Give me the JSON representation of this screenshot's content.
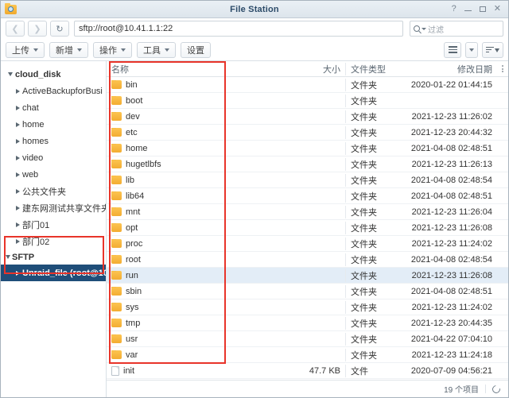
{
  "window": {
    "title": "File Station",
    "icon": "folder-search-icon",
    "controls": [
      {
        "name": "help-button",
        "glyph": "?"
      },
      {
        "name": "minimize-button",
        "glyph": "—"
      },
      {
        "name": "maximize-button",
        "glyph": "□"
      },
      {
        "name": "close-button",
        "glyph": "✕"
      }
    ]
  },
  "nav": {
    "back_icon": "chevron-left-icon",
    "forward_icon": "chevron-right-icon",
    "refresh_icon": "refresh-icon",
    "address_value": "sftp://root@10.41.1.1:22",
    "filter_placeholder": "过滤",
    "filter_icon": "search-icon"
  },
  "toolbar": {
    "buttons": [
      {
        "label": "上传",
        "name": "upload-button",
        "has_caret": true
      },
      {
        "label": "新增",
        "name": "create-button",
        "has_caret": true
      },
      {
        "label": "操作",
        "name": "action-button",
        "has_caret": true
      },
      {
        "label": "工具",
        "name": "tools-button",
        "has_caret": true
      },
      {
        "label": "设置",
        "name": "settings-button",
        "has_caret": false
      }
    ],
    "view_button": "list-view-icon",
    "view_caret": "chevron-down-icon",
    "sort_button": "sort-descending-icon"
  },
  "sidebar": {
    "root": {
      "label": "cloud_disk",
      "expanded": true
    },
    "items": [
      {
        "label": "ActiveBackupforBusi",
        "name": "sidebar-item-activebackupforbusi"
      },
      {
        "label": "chat",
        "name": "sidebar-item-chat"
      },
      {
        "label": "home",
        "name": "sidebar-item-home"
      },
      {
        "label": "homes",
        "name": "sidebar-item-homes"
      },
      {
        "label": "video",
        "name": "sidebar-item-video"
      },
      {
        "label": "web",
        "name": "sidebar-item-web"
      },
      {
        "label": "公共文件夹",
        "name": "sidebar-item-public-folder"
      },
      {
        "label": "建东网测试共享文件夹",
        "name": "sidebar-item-shared-test-folder"
      },
      {
        "label": "部门01",
        "name": "sidebar-item-dept01"
      },
      {
        "label": "部门02",
        "name": "sidebar-item-dept02"
      }
    ],
    "section": {
      "label": "SFTP",
      "expanded": true
    },
    "sftp_items": [
      {
        "label": "Unraid_file (root@10",
        "name": "sidebar-item-unraid-file",
        "selected": true
      }
    ]
  },
  "filelist": {
    "columns": {
      "name": "名称",
      "size": "大小",
      "type": "文件类型",
      "date": "修改日期",
      "menu_icon": "column-options-icon"
    },
    "rows": [
      {
        "name": "bin",
        "icon": "folder-icon",
        "size": "",
        "type": "文件夹",
        "date": "2020-01-22 01:44:15",
        "highlighted": false
      },
      {
        "name": "boot",
        "icon": "folder-icon",
        "size": "",
        "type": "文件夹",
        "date": "",
        "highlighted": false
      },
      {
        "name": "dev",
        "icon": "folder-icon",
        "size": "",
        "type": "文件夹",
        "date": "2021-12-23 11:26:02",
        "highlighted": false
      },
      {
        "name": "etc",
        "icon": "folder-icon",
        "size": "",
        "type": "文件夹",
        "date": "2021-12-23 20:44:32",
        "highlighted": false
      },
      {
        "name": "home",
        "icon": "folder-icon",
        "size": "",
        "type": "文件夹",
        "date": "2021-04-08 02:48:51",
        "highlighted": false
      },
      {
        "name": "hugetlbfs",
        "icon": "folder-icon",
        "size": "",
        "type": "文件夹",
        "date": "2021-12-23 11:26:13",
        "highlighted": false
      },
      {
        "name": "lib",
        "icon": "folder-icon",
        "size": "",
        "type": "文件夹",
        "date": "2021-04-08 02:48:54",
        "highlighted": false
      },
      {
        "name": "lib64",
        "icon": "folder-icon",
        "size": "",
        "type": "文件夹",
        "date": "2021-04-08 02:48:51",
        "highlighted": false
      },
      {
        "name": "mnt",
        "icon": "folder-icon",
        "size": "",
        "type": "文件夹",
        "date": "2021-12-23 11:26:04",
        "highlighted": false
      },
      {
        "name": "opt",
        "icon": "folder-icon",
        "size": "",
        "type": "文件夹",
        "date": "2021-12-23 11:26:08",
        "highlighted": false
      },
      {
        "name": "proc",
        "icon": "folder-icon",
        "size": "",
        "type": "文件夹",
        "date": "2021-12-23 11:24:02",
        "highlighted": false
      },
      {
        "name": "root",
        "icon": "folder-icon",
        "size": "",
        "type": "文件夹",
        "date": "2021-04-08 02:48:54",
        "highlighted": false
      },
      {
        "name": "run",
        "icon": "folder-icon",
        "size": "",
        "type": "文件夹",
        "date": "2021-12-23 11:26:08",
        "highlighted": true
      },
      {
        "name": "sbin",
        "icon": "folder-icon",
        "size": "",
        "type": "文件夹",
        "date": "2021-04-08 02:48:51",
        "highlighted": false
      },
      {
        "name": "sys",
        "icon": "folder-icon",
        "size": "",
        "type": "文件夹",
        "date": "2021-12-23 11:24:02",
        "highlighted": false
      },
      {
        "name": "tmp",
        "icon": "folder-icon",
        "size": "",
        "type": "文件夹",
        "date": "2021-12-23 20:44:35",
        "highlighted": false
      },
      {
        "name": "usr",
        "icon": "folder-icon",
        "size": "",
        "type": "文件夹",
        "date": "2021-04-22 07:04:10",
        "highlighted": false
      },
      {
        "name": "var",
        "icon": "folder-icon",
        "size": "",
        "type": "文件夹",
        "date": "2021-12-23 11:24:18",
        "highlighted": false
      },
      {
        "name": "init",
        "icon": "file-icon",
        "size": "47.7 KB",
        "type": "文件",
        "date": "2020-07-09 04:56:21",
        "highlighted": false
      }
    ]
  },
  "statusbar": {
    "item_count": "19 个项目",
    "refresh_icon": "refresh-icon"
  },
  "annotations": {
    "accent_color": "#e8342a",
    "boxes": [
      {
        "name": "annotation-box-sidebar"
      },
      {
        "name": "annotation-box-filelist"
      }
    ]
  }
}
